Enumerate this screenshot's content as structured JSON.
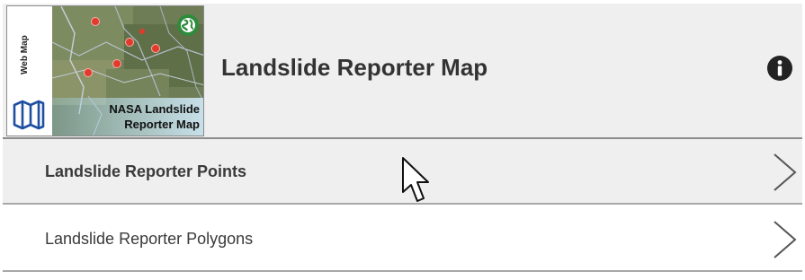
{
  "header": {
    "thumbnail": {
      "side_label": "Web Map",
      "caption_line1": "NASA Landslide",
      "caption_line2": "Reporter Map",
      "side_icon": "map-icon",
      "badge_icon": "globe-icon"
    },
    "title": "Landslide Reporter Map",
    "info_icon": "info-icon"
  },
  "list": {
    "items": [
      {
        "label": "Landslide Reporter Points",
        "icon": "chevron-right-icon"
      },
      {
        "label": "Landslide Reporter Polygons",
        "icon": "chevron-right-icon"
      }
    ]
  },
  "colors": {
    "header_bg": "#efefef",
    "title_text": "#333333",
    "row_selected_bg": "#efefef",
    "divider": "#a8a8a8",
    "marker_red": "#e23a2c",
    "badge_green": "#2e8b3c"
  }
}
